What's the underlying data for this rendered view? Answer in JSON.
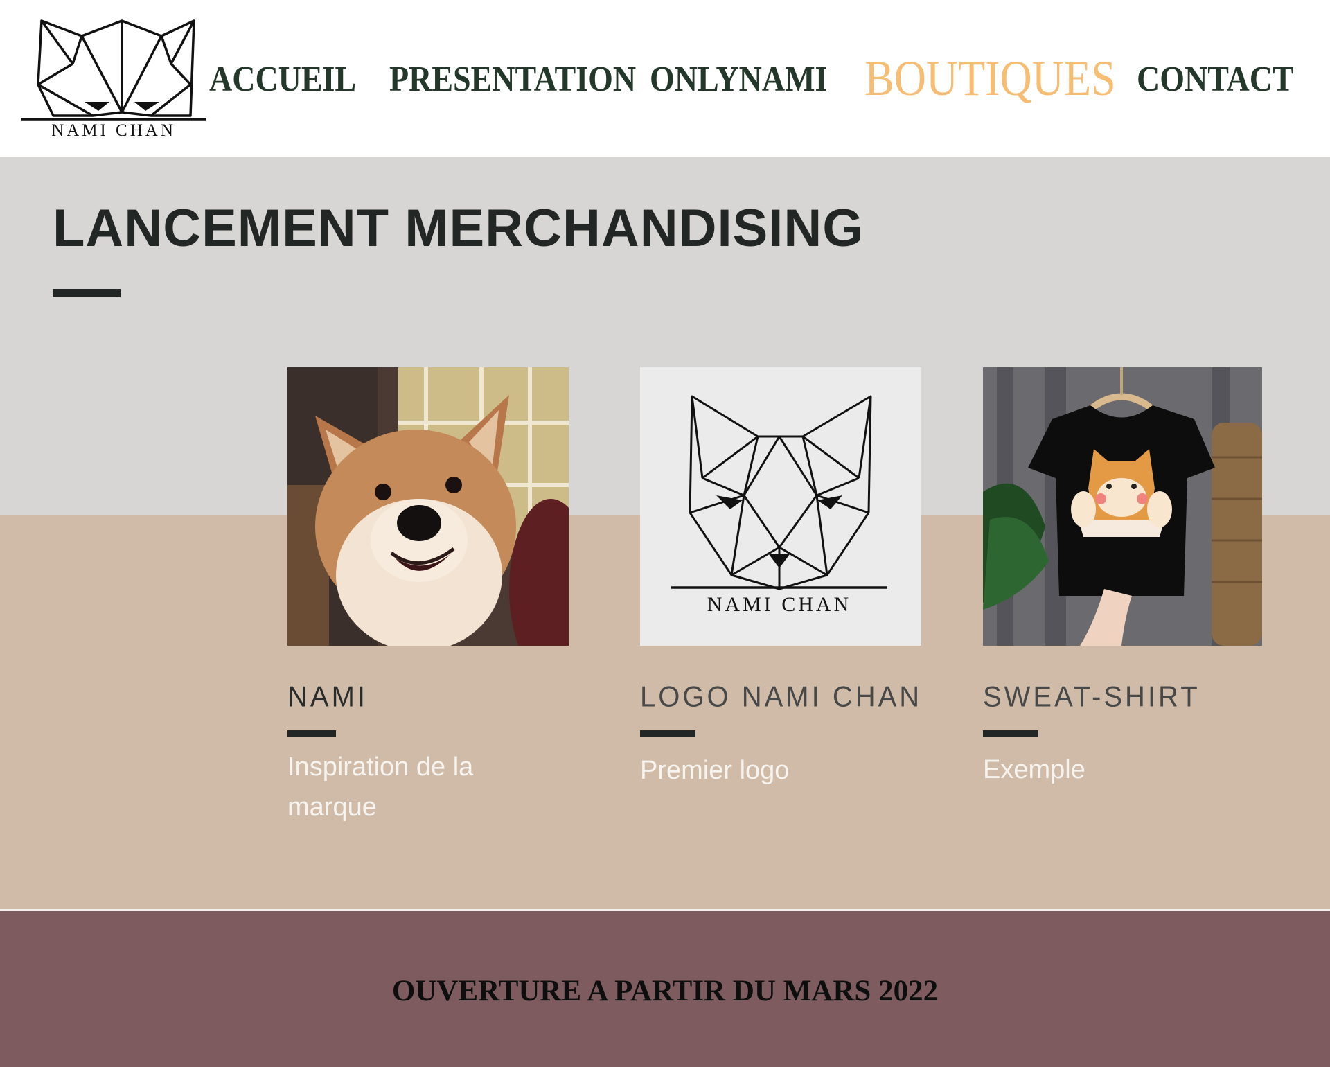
{
  "brand": {
    "logo_text": "NAMI CHAN"
  },
  "nav": {
    "items": [
      {
        "label": "ACCUEIL"
      },
      {
        "label": "PRESENTATION"
      },
      {
        "label": "ONLYNAMI"
      },
      {
        "label": "BOUTIQUES",
        "active": true
      },
      {
        "label": "CONTACT"
      }
    ]
  },
  "main": {
    "title": "LANCEMENT MERCHANDISING",
    "cards": [
      {
        "title": "NAMI",
        "description": "Inspiration de la marque"
      },
      {
        "title": "LOGO NAMI CHAN",
        "description": "Premier logo",
        "image_text": "NAMI CHAN"
      },
      {
        "title": "SWEAT-SHIRT",
        "description": "Exemple"
      }
    ]
  },
  "footer": {
    "text": "OUVERTURE A PARTIR DU MARS 2022"
  },
  "colors": {
    "nav_text": "#23372a",
    "nav_active": "#f6bd73",
    "band_top": "#d7d6d5",
    "band_bottom": "#cfbba8",
    "footer_bg": "#7d5b5f",
    "heading_dark": "#222625",
    "description_text": "#f7f3ee"
  }
}
